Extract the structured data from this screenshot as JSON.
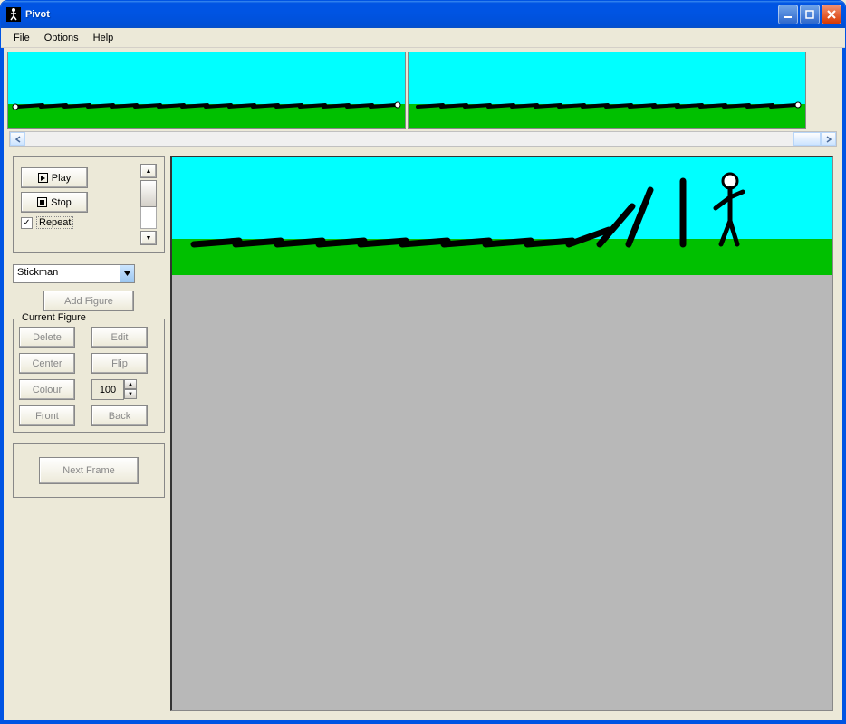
{
  "window": {
    "title": "Pivot"
  },
  "menu": {
    "file": "File",
    "options": "Options",
    "help": "Help"
  },
  "playback": {
    "play": "Play",
    "stop": "Stop",
    "repeat": "Repeat",
    "repeat_checked": true
  },
  "figure": {
    "dropdown_value": "Stickman",
    "add": "Add Figure",
    "group_label": "Current Figure",
    "delete": "Delete",
    "edit": "Edit",
    "center": "Center",
    "flip": "Flip",
    "colour": "Colour",
    "size_value": "100",
    "front": "Front",
    "back": "Back"
  },
  "next_frame": "Next Frame",
  "colors": {
    "sky": "#00ffff",
    "ground": "#00c000",
    "titlebar": "#0054e3"
  }
}
